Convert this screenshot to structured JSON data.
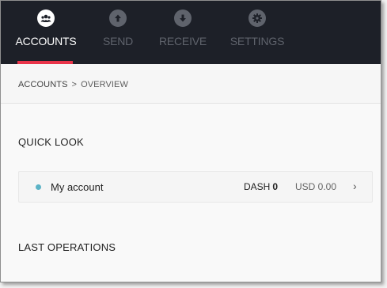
{
  "nav": {
    "tabs": [
      {
        "label": "ACCOUNTS",
        "icon": "accounts-icon",
        "active": true
      },
      {
        "label": "SEND",
        "icon": "send-icon",
        "active": false
      },
      {
        "label": "RECEIVE",
        "icon": "receive-icon",
        "active": false
      },
      {
        "label": "SETTINGS",
        "icon": "settings-icon",
        "active": false
      }
    ]
  },
  "breadcrumb": {
    "first": "ACCOUNTS",
    "separator": ">",
    "current": "OVERVIEW"
  },
  "quick_look": {
    "title": "QUICK LOOK",
    "accounts": [
      {
        "name": "My account",
        "currency": "DASH",
        "amount": "0",
        "fiat": "USD 0.00",
        "status_color": "#5cb3c6"
      }
    ]
  },
  "last_operations": {
    "title": "LAST OPERATIONS"
  },
  "colors": {
    "topbar": "#1d2028",
    "accent": "#e9344a",
    "active_text": "#ffffff",
    "inactive_text": "#5f636c"
  }
}
